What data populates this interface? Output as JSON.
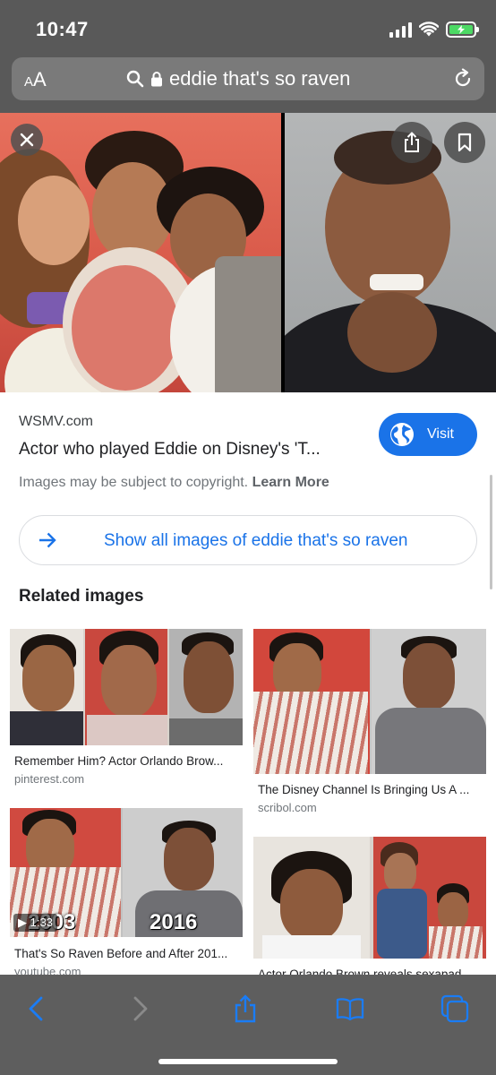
{
  "status_bar": {
    "time": "10:47",
    "battery_color": "#4cd964"
  },
  "address_bar": {
    "text_size_label_small": "A",
    "text_size_label_large": "A",
    "url_text": "eddie that's so raven",
    "icons": [
      "search-icon",
      "lock-icon",
      "reload-icon"
    ]
  },
  "viewer": {
    "icons": [
      "close-icon",
      "share-icon",
      "bookmark-icon"
    ]
  },
  "result": {
    "source": "WSMV.com",
    "title": "Actor who played Eddie on Disney's 'T...",
    "visit_label": "Visit",
    "copyright_text": "Images may be subject to copyright.",
    "learn_more_label": "Learn More",
    "show_all_label": "Show all images of eddie that's so raven",
    "accent_color": "#1a73e8"
  },
  "related": {
    "heading": "Related images",
    "items": [
      {
        "caption": "Remember Him? Actor Orlando Brow...",
        "domain": "pinterest.com"
      },
      {
        "caption": "The Disney Channel Is Bringing Us A ...",
        "domain": "scribol.com"
      },
      {
        "caption": "That's So Raven Before and After 201...",
        "domain": "youtube.com",
        "duration": "1:33",
        "year_left": "2003",
        "year_right": "2016"
      },
      {
        "caption": "Actor Orlando Brown reveals sexapad...",
        "domain": ""
      }
    ]
  },
  "toolbar": {
    "icons": [
      "back-icon",
      "forward-icon",
      "share-icon",
      "bookmarks-icon",
      "tabs-icon"
    ]
  }
}
